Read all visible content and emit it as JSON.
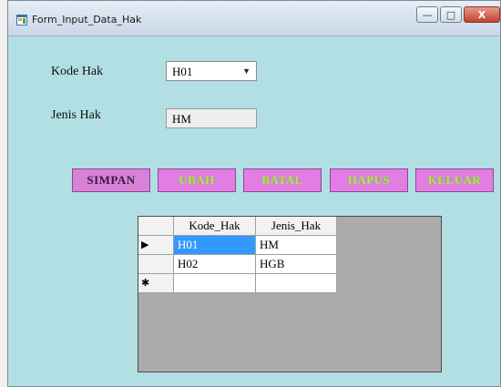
{
  "window": {
    "title": "Form_Input_Data_Hak"
  },
  "window_controls": {
    "minimize": "—",
    "maximize": "□",
    "close": "X"
  },
  "form": {
    "kode_label": "Kode Hak",
    "kode_value": "H01",
    "jenis_label": "Jenis Hak",
    "jenis_value": "HM"
  },
  "buttons": {
    "simpan": "SIMPAN",
    "ubah": "UBAH",
    "batal": "BATAL",
    "hapus": "HAPUS",
    "keluar": "KELUAR"
  },
  "grid": {
    "columns": [
      "Kode_Hak",
      "Jenis_Hak"
    ],
    "rows": [
      {
        "marker": "▶",
        "kode": "H01",
        "jenis": "HM"
      },
      {
        "marker": "",
        "kode": "H02",
        "jenis": "HGB"
      },
      {
        "marker": "✱",
        "kode": "",
        "jenis": ""
      }
    ],
    "selected_row": 0
  },
  "colors": {
    "background": "#b2dfe3",
    "button": "#e27ee3",
    "button_text_lime": "#a4f04a",
    "selection": "#3399ff"
  }
}
